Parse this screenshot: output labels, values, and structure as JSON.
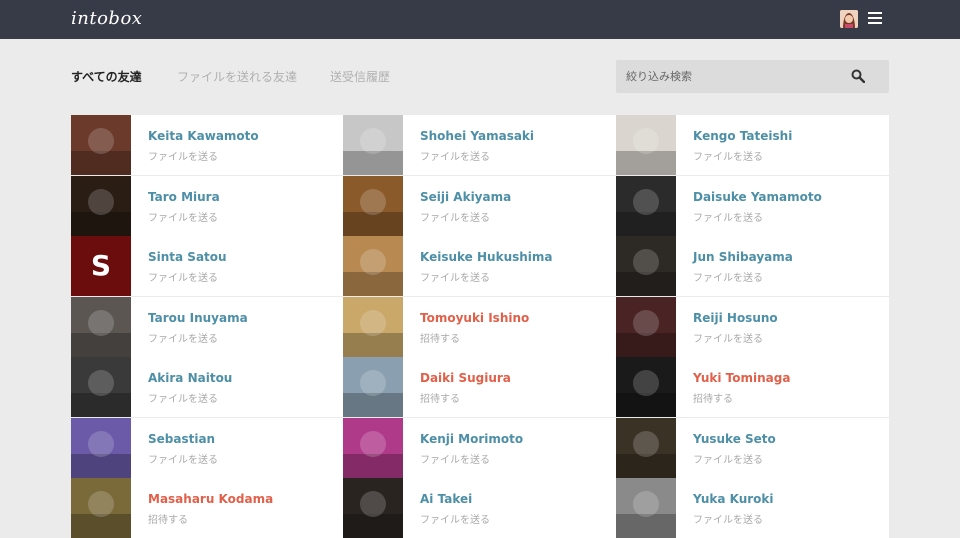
{
  "app": {
    "logo": "intobox"
  },
  "header": {
    "avatar_icon": "user-avatar-icon",
    "menu_icon": "hamburger-menu-icon"
  },
  "tabs": [
    {
      "label": "すべての友達",
      "active": true
    },
    {
      "label": "ファイルを送れる友達",
      "active": false
    },
    {
      "label": "送受信履歴",
      "active": false
    }
  ],
  "search": {
    "placeholder": "絞り込み検索",
    "icon": "search-icon"
  },
  "colors": {
    "topbar": "#363b47",
    "name": "#4d8fa6",
    "invite": "#e1604a",
    "sub": "#a9a9a9"
  },
  "friends": [
    {
      "name": "Keita Kawamoto",
      "action": "ファイルを送る",
      "invite": false,
      "avatar": "#6b3a2a"
    },
    {
      "name": "Shohei Yamasaki",
      "action": "ファイルを送る",
      "invite": false,
      "avatar": "#c7c7c7"
    },
    {
      "name": "Kengo Tateishi",
      "action": "ファイルを送る",
      "invite": false,
      "avatar": "#dad6cf"
    },
    {
      "name": "Taro Miura",
      "action": "ファイルを送る",
      "invite": false,
      "avatar": "#2a1d14"
    },
    {
      "name": "Seiji Akiyama",
      "action": "ファイルを送る",
      "invite": false,
      "avatar": "#8a5a2a"
    },
    {
      "name": "Daisuke Yamamoto",
      "action": "ファイルを送る",
      "invite": false,
      "avatar": "#2b2b2b"
    },
    {
      "name": "Sinta Satou",
      "action": "ファイルを送る",
      "invite": false,
      "avatar": "#6b0d0d",
      "initial": "S"
    },
    {
      "name": "Keisuke Hukushima",
      "action": "ファイルを送る",
      "invite": false,
      "avatar": "#b88a52"
    },
    {
      "name": "Jun Shibayama",
      "action": "ファイルを送る",
      "invite": false,
      "avatar": "#2d2924"
    },
    {
      "name": "Tarou Inuyama",
      "action": "ファイルを送る",
      "invite": false,
      "avatar": "#5b5652"
    },
    {
      "name": "Tomoyuki Ishino",
      "action": "招待する",
      "invite": true,
      "avatar": "#c9a86a"
    },
    {
      "name": "Reiji Hosuno",
      "action": "ファイルを送る",
      "invite": false,
      "avatar": "#4a2424"
    },
    {
      "name": "Akira Naitou",
      "action": "ファイルを送る",
      "invite": false,
      "avatar": "#3a3a3a"
    },
    {
      "name": "Daiki Sugiura",
      "action": "招待する",
      "invite": true,
      "avatar": "#8aa0b0"
    },
    {
      "name": "Yuki Tominaga",
      "action": "招待する",
      "invite": true,
      "avatar": "#1a1a1a"
    },
    {
      "name": "Sebastian",
      "action": "ファイルを送る",
      "invite": false,
      "avatar": "#6a5aa8"
    },
    {
      "name": "Kenji Morimoto",
      "action": "ファイルを送る",
      "invite": false,
      "avatar": "#b03a8a"
    },
    {
      "name": "Yusuke Seto",
      "action": "ファイルを送る",
      "invite": false,
      "avatar": "#3b3226"
    },
    {
      "name": "Masaharu Kodama",
      "action": "招待する",
      "invite": true,
      "avatar": "#7a6a3a"
    },
    {
      "name": "Ai Takei",
      "action": "ファイルを送る",
      "invite": false,
      "avatar": "#2a2420"
    },
    {
      "name": "Yuka Kuroki",
      "action": "ファイルを送る",
      "invite": false,
      "avatar": "#8a8a8a"
    }
  ]
}
